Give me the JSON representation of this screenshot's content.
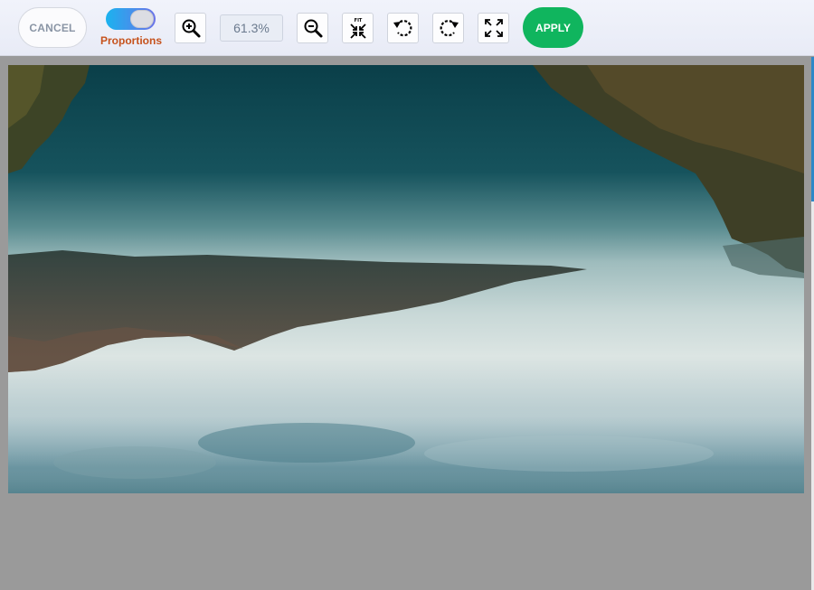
{
  "toolbar": {
    "cancel_label": "CANCEL",
    "proportions_label": "Proportions",
    "proportions_enabled": true,
    "zoom_value": "61.3%",
    "fit_label": "FIT",
    "apply_label": "APPLY"
  },
  "icons": {
    "zoom_in": "zoom-in-icon",
    "zoom_out": "zoom-out-icon",
    "fit": "fit-to-screen-icon",
    "rotate_left": "rotate-left-icon",
    "rotate_right": "rotate-right-icon",
    "fullscreen": "fullscreen-icon"
  },
  "colors": {
    "apply_button": "#10b55e",
    "proportions_label": "#c6521c",
    "toggle_gradient_start": "#1ab3ef",
    "toggle_gradient_end": "#6c73e8",
    "canvas_background": "#9a9a9a"
  },
  "image": {
    "description": "Upside-down landscape photo of mountains, lake, fog and trees"
  }
}
